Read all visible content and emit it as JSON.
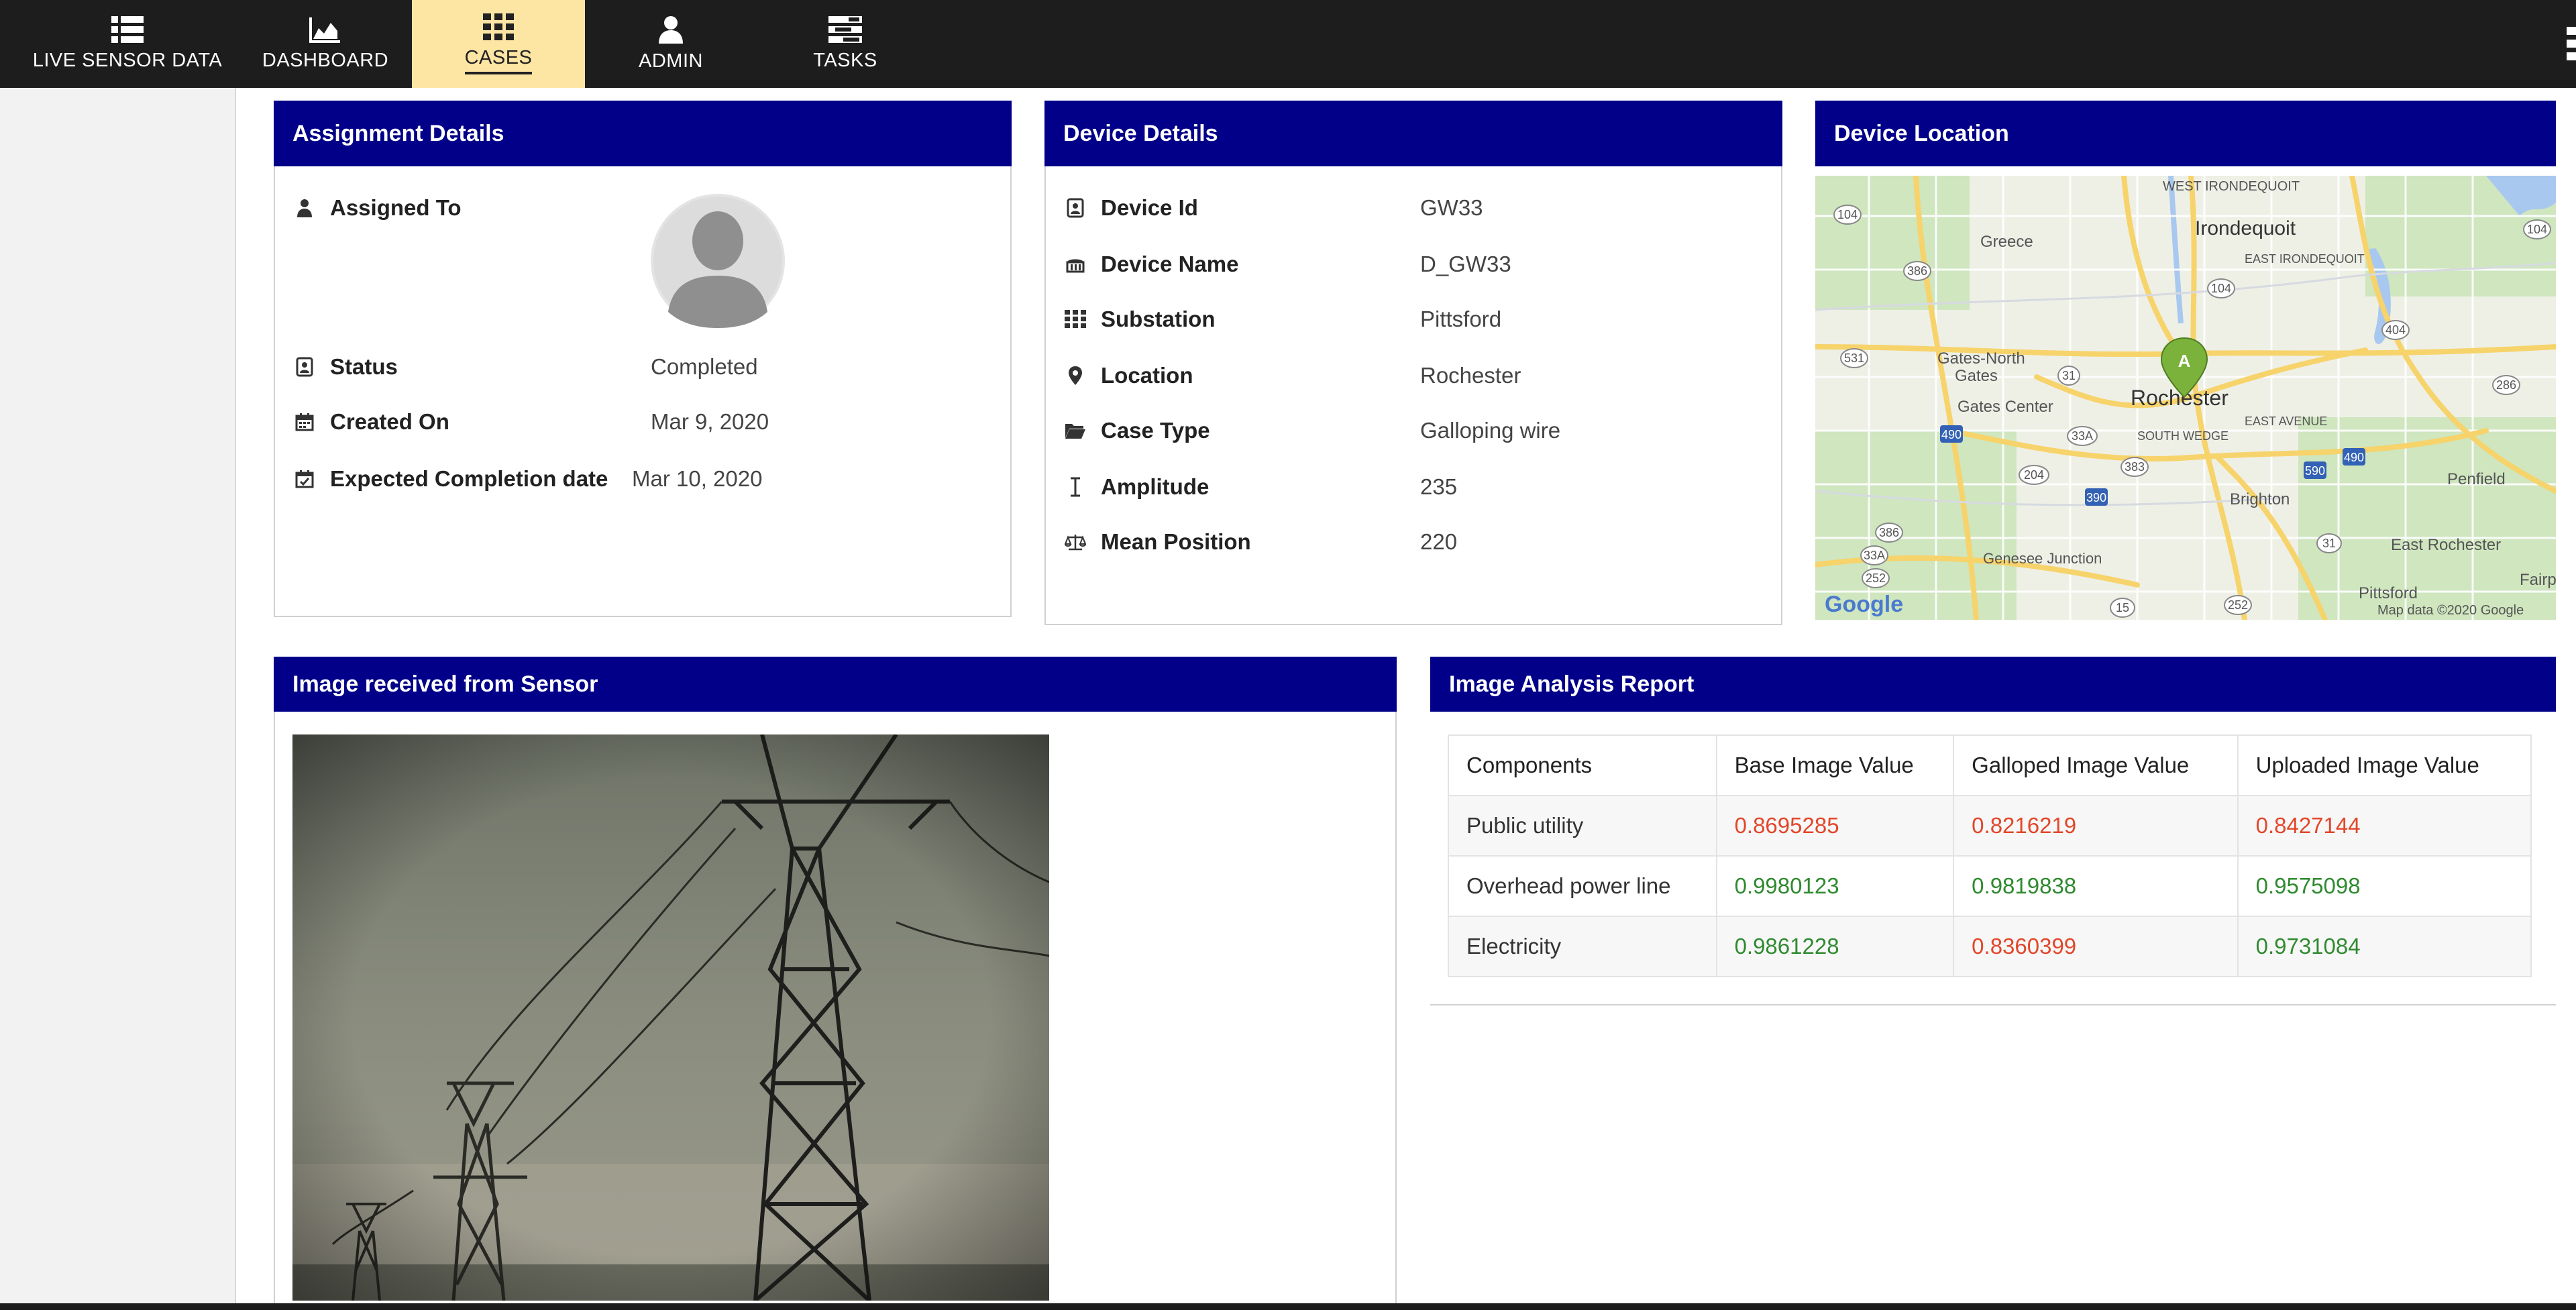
{
  "nav": {
    "items": [
      {
        "label": "LIVE SENSOR DATA",
        "icon": "list-icon"
      },
      {
        "label": "DASHBOARD",
        "icon": "area-chart-icon"
      },
      {
        "label": "CASES",
        "icon": "grid-icon",
        "active": true
      },
      {
        "label": "ADMIN",
        "icon": "user-icon"
      },
      {
        "label": "TASKS",
        "icon": "tasks-icon"
      }
    ]
  },
  "assignment": {
    "title": "Assignment Details",
    "assigned_to_label": "Assigned To",
    "status_label": "Status",
    "status_value": "Completed",
    "created_label": "Created On",
    "created_value": "Mar 9, 2020",
    "expected_label": "Expected Completion date",
    "expected_value": "Mar 10, 2020"
  },
  "device": {
    "title": "Device Details",
    "rows": [
      {
        "label": "Device Id",
        "value": "GW33",
        "icon": "id-card-icon"
      },
      {
        "label": "Device Name",
        "value": "D_GW33",
        "icon": "device-icon"
      },
      {
        "label": "Substation",
        "value": "Pittsford",
        "icon": "grid-icon"
      },
      {
        "label": "Location",
        "value": "Rochester",
        "icon": "map-pin-icon"
      },
      {
        "label": "Case Type",
        "value": "Galloping wire",
        "icon": "folder-icon"
      },
      {
        "label": "Amplitude",
        "value": "235",
        "icon": "amplitude-icon"
      },
      {
        "label": "Mean Position",
        "value": "220",
        "icon": "balance-icon"
      }
    ]
  },
  "location": {
    "title": "Device Location",
    "marker_label": "A",
    "map_labels": {
      "west_irondequoit": "WEST IRONDEQUOIT",
      "irondequoit": "Irondequoit",
      "east_irondequoit": "EAST IRONDEQUOIT",
      "greece": "Greece",
      "gates_north": "Gates-North",
      "gates": "Gates",
      "gates_center": "Gates Center",
      "rochester": "Rochester",
      "south_wedge": "SOUTH WEDGE",
      "east_avenue": "EAST AVENUE",
      "brighton": "Brighton",
      "penfield": "Penfield",
      "east_rochester": "East Rochester",
      "genesee_junction": "Genesee Junction",
      "pittsford": "Pittsford",
      "fairport": "Fairpo",
      "attribution": "Map data ©2020 Google",
      "google": "Google"
    },
    "shields": [
      "104",
      "104",
      "386",
      "104",
      "404",
      "531",
      "31",
      "286",
      "490",
      "33A",
      "590",
      "490",
      "204",
      "383",
      "390",
      "386",
      "33A",
      "252",
      "31",
      "15",
      "252"
    ]
  },
  "sensor": {
    "title": "Image received from Sensor"
  },
  "report": {
    "title": "Image Analysis Report",
    "columns": [
      "Components",
      "Base Image Value",
      "Galloped Image Value",
      "Uploaded Image Value"
    ],
    "rows": [
      {
        "name": "Public utility",
        "values": [
          "0.8695285",
          "0.8216219",
          "0.8427144"
        ],
        "status": [
          "red",
          "red",
          "red"
        ]
      },
      {
        "name": "Overhead power line",
        "values": [
          "0.9980123",
          "0.9819838",
          "0.9575098"
        ],
        "status": [
          "green",
          "green",
          "green"
        ]
      },
      {
        "name": "Electricity",
        "values": [
          "0.9861228",
          "0.8360399",
          "0.9731084"
        ],
        "status": [
          "green",
          "red",
          "green"
        ]
      }
    ],
    "status_colors": {
      "red": "#e2472a",
      "green": "#2f8a2f"
    }
  },
  "colors": {
    "header": "#020088",
    "nav_bg": "#1d1d1d",
    "nav_active": "#fde5a4"
  }
}
